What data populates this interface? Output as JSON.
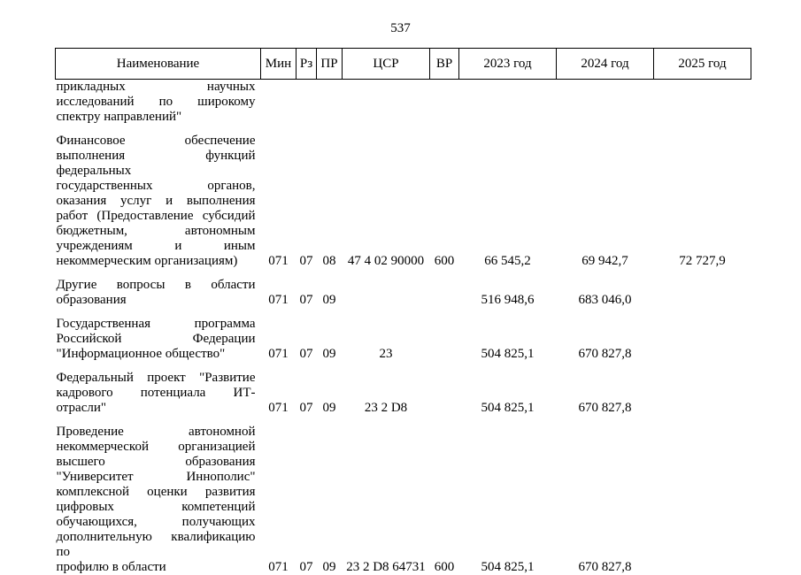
{
  "page": {
    "number": "537"
  },
  "table": {
    "headers": [
      {
        "key": "name",
        "label": "Наименование"
      },
      {
        "key": "min",
        "label": "Мин"
      },
      {
        "key": "rz",
        "label": "Рз"
      },
      {
        "key": "pr",
        "label": "ПР"
      },
      {
        "key": "csr",
        "label": "ЦСР"
      },
      {
        "key": "vr",
        "label": "ВР"
      },
      {
        "key": "y2023",
        "label": "2023 год"
      },
      {
        "key": "y2024",
        "label": "2024 год"
      },
      {
        "key": "y2025",
        "label": "2025 год"
      }
    ],
    "rows": [
      {
        "id": "row-prikladnyh",
        "name_lines": [
          "прикладных научных",
          "исследований по широкому",
          "спектру направлений\""
        ],
        "min": "",
        "rz": "",
        "pr": "",
        "csr": "",
        "vr": "",
        "y2023": "",
        "y2024": "",
        "y2025": ""
      },
      {
        "id": "row-finansovoe-obespechenie",
        "name_lines": [
          "Финансовое обеспечение",
          "выполнения функций федеральных",
          "государственных органов,",
          "оказания услуг и выполнения",
          "работ (Предоставление субсидий",
          "бюджетным, автономным",
          "учреждениям и иным",
          "некоммерческим организациям)"
        ],
        "min": "071",
        "rz": "07",
        "pr": "08",
        "csr": "47 4 02 90000",
        "vr": "600",
        "y2023": "66 545,2",
        "y2024": "69 942,7",
        "y2025": "72 727,9"
      },
      {
        "id": "row-drugie-voprosy",
        "name_lines": [
          "Другие вопросы в области",
          "образования"
        ],
        "min": "071",
        "rz": "07",
        "pr": "09",
        "csr": "",
        "vr": "",
        "y2023": "516 948,6",
        "y2024": "683 046,0",
        "y2025": ""
      },
      {
        "id": "row-gosprogramma-informobshchestvo",
        "name_lines": [
          "Государственная программа",
          "Российской Федерации",
          "\"Информационное общество\""
        ],
        "min": "071",
        "rz": "07",
        "pr": "09",
        "csr": "23",
        "vr": "",
        "y2023": "504 825,1",
        "y2024": "670 827,8",
        "y2025": ""
      },
      {
        "id": "row-federalnyi-proekt-it",
        "name_lines": [
          "Федеральный проект \"Развитие",
          "кадрового потенциала ИТ-отрасли\""
        ],
        "min": "071",
        "rz": "07",
        "pr": "09",
        "csr": "23 2 D8",
        "vr": "",
        "y2023": "504 825,1",
        "y2024": "670 827,8",
        "y2025": ""
      },
      {
        "id": "row-provedenie-innopolis",
        "name_lines": [
          "Проведение автономной",
          "некоммерческой организацией",
          "высшего образования",
          "\"Университет Иннополис\"",
          "комплексной оценки развития",
          "цифровых компетенций",
          "обучающихся, получающих",
          "дополнительную квалификацию по",
          "профилю в области"
        ],
        "min": "071",
        "rz": "07",
        "pr": "09",
        "csr": "23 2 D8 64731",
        "vr": "600",
        "y2023": "504 825,1",
        "y2024": "670 827,8",
        "y2025": ""
      }
    ]
  }
}
